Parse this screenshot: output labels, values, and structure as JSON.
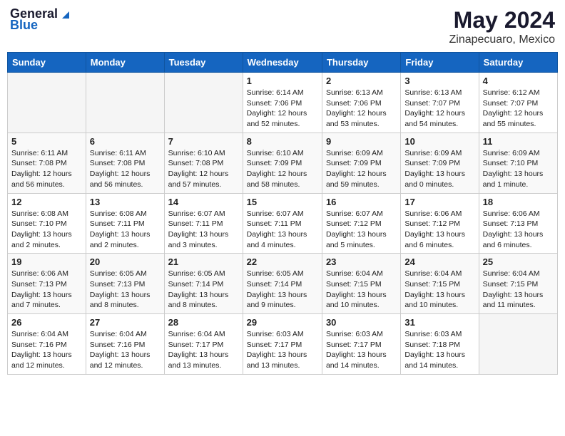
{
  "header": {
    "logo_general": "General",
    "logo_blue": "Blue",
    "month": "May 2024",
    "location": "Zinapecuaro, Mexico"
  },
  "days_of_week": [
    "Sunday",
    "Monday",
    "Tuesday",
    "Wednesday",
    "Thursday",
    "Friday",
    "Saturday"
  ],
  "weeks": [
    [
      {
        "day": "",
        "info": ""
      },
      {
        "day": "",
        "info": ""
      },
      {
        "day": "",
        "info": ""
      },
      {
        "day": "1",
        "info": "Sunrise: 6:14 AM\nSunset: 7:06 PM\nDaylight: 12 hours\nand 52 minutes."
      },
      {
        "day": "2",
        "info": "Sunrise: 6:13 AM\nSunset: 7:06 PM\nDaylight: 12 hours\nand 53 minutes."
      },
      {
        "day": "3",
        "info": "Sunrise: 6:13 AM\nSunset: 7:07 PM\nDaylight: 12 hours\nand 54 minutes."
      },
      {
        "day": "4",
        "info": "Sunrise: 6:12 AM\nSunset: 7:07 PM\nDaylight: 12 hours\nand 55 minutes."
      }
    ],
    [
      {
        "day": "5",
        "info": "Sunrise: 6:11 AM\nSunset: 7:08 PM\nDaylight: 12 hours\nand 56 minutes."
      },
      {
        "day": "6",
        "info": "Sunrise: 6:11 AM\nSunset: 7:08 PM\nDaylight: 12 hours\nand 56 minutes."
      },
      {
        "day": "7",
        "info": "Sunrise: 6:10 AM\nSunset: 7:08 PM\nDaylight: 12 hours\nand 57 minutes."
      },
      {
        "day": "8",
        "info": "Sunrise: 6:10 AM\nSunset: 7:09 PM\nDaylight: 12 hours\nand 58 minutes."
      },
      {
        "day": "9",
        "info": "Sunrise: 6:09 AM\nSunset: 7:09 PM\nDaylight: 12 hours\nand 59 minutes."
      },
      {
        "day": "10",
        "info": "Sunrise: 6:09 AM\nSunset: 7:09 PM\nDaylight: 13 hours\nand 0 minutes."
      },
      {
        "day": "11",
        "info": "Sunrise: 6:09 AM\nSunset: 7:10 PM\nDaylight: 13 hours\nand 1 minute."
      }
    ],
    [
      {
        "day": "12",
        "info": "Sunrise: 6:08 AM\nSunset: 7:10 PM\nDaylight: 13 hours\nand 2 minutes."
      },
      {
        "day": "13",
        "info": "Sunrise: 6:08 AM\nSunset: 7:11 PM\nDaylight: 13 hours\nand 2 minutes."
      },
      {
        "day": "14",
        "info": "Sunrise: 6:07 AM\nSunset: 7:11 PM\nDaylight: 13 hours\nand 3 minutes."
      },
      {
        "day": "15",
        "info": "Sunrise: 6:07 AM\nSunset: 7:11 PM\nDaylight: 13 hours\nand 4 minutes."
      },
      {
        "day": "16",
        "info": "Sunrise: 6:07 AM\nSunset: 7:12 PM\nDaylight: 13 hours\nand 5 minutes."
      },
      {
        "day": "17",
        "info": "Sunrise: 6:06 AM\nSunset: 7:12 PM\nDaylight: 13 hours\nand 6 minutes."
      },
      {
        "day": "18",
        "info": "Sunrise: 6:06 AM\nSunset: 7:13 PM\nDaylight: 13 hours\nand 6 minutes."
      }
    ],
    [
      {
        "day": "19",
        "info": "Sunrise: 6:06 AM\nSunset: 7:13 PM\nDaylight: 13 hours\nand 7 minutes."
      },
      {
        "day": "20",
        "info": "Sunrise: 6:05 AM\nSunset: 7:13 PM\nDaylight: 13 hours\nand 8 minutes."
      },
      {
        "day": "21",
        "info": "Sunrise: 6:05 AM\nSunset: 7:14 PM\nDaylight: 13 hours\nand 8 minutes."
      },
      {
        "day": "22",
        "info": "Sunrise: 6:05 AM\nSunset: 7:14 PM\nDaylight: 13 hours\nand 9 minutes."
      },
      {
        "day": "23",
        "info": "Sunrise: 6:04 AM\nSunset: 7:15 PM\nDaylight: 13 hours\nand 10 minutes."
      },
      {
        "day": "24",
        "info": "Sunrise: 6:04 AM\nSunset: 7:15 PM\nDaylight: 13 hours\nand 10 minutes."
      },
      {
        "day": "25",
        "info": "Sunrise: 6:04 AM\nSunset: 7:15 PM\nDaylight: 13 hours\nand 11 minutes."
      }
    ],
    [
      {
        "day": "26",
        "info": "Sunrise: 6:04 AM\nSunset: 7:16 PM\nDaylight: 13 hours\nand 12 minutes."
      },
      {
        "day": "27",
        "info": "Sunrise: 6:04 AM\nSunset: 7:16 PM\nDaylight: 13 hours\nand 12 minutes."
      },
      {
        "day": "28",
        "info": "Sunrise: 6:04 AM\nSunset: 7:17 PM\nDaylight: 13 hours\nand 13 minutes."
      },
      {
        "day": "29",
        "info": "Sunrise: 6:03 AM\nSunset: 7:17 PM\nDaylight: 13 hours\nand 13 minutes."
      },
      {
        "day": "30",
        "info": "Sunrise: 6:03 AM\nSunset: 7:17 PM\nDaylight: 13 hours\nand 14 minutes."
      },
      {
        "day": "31",
        "info": "Sunrise: 6:03 AM\nSunset: 7:18 PM\nDaylight: 13 hours\nand 14 minutes."
      },
      {
        "day": "",
        "info": ""
      }
    ]
  ]
}
